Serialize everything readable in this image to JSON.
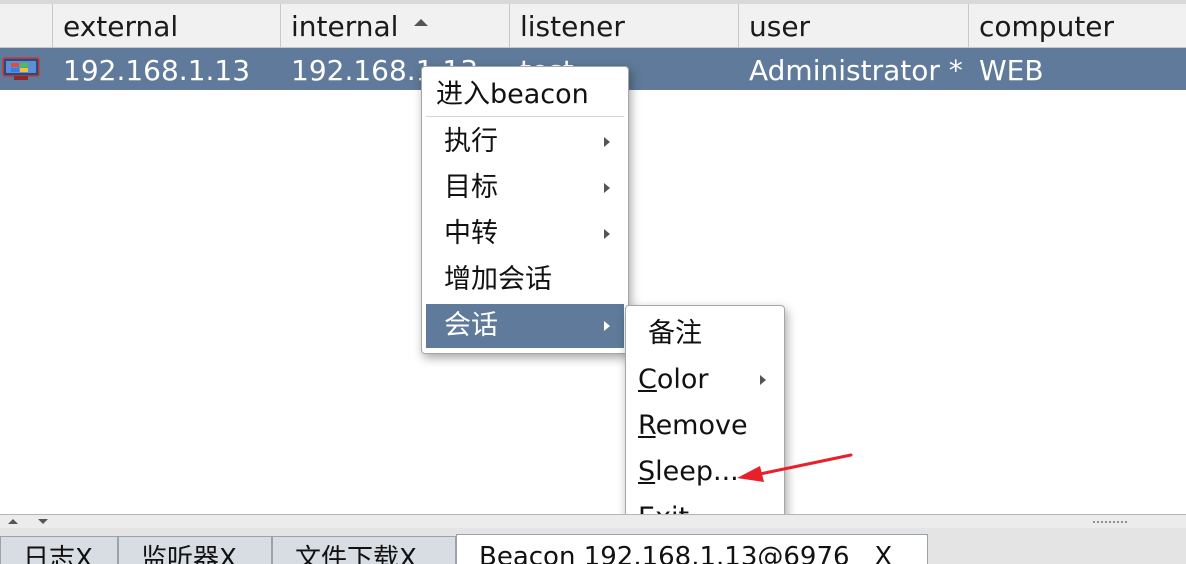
{
  "table": {
    "columns": {
      "external": "external",
      "internal": "internal",
      "listener": "listener",
      "user": "user",
      "computer": "computer"
    },
    "sorted_column": "internal",
    "rows": [
      {
        "external": "192.168.1.13",
        "internal": "192.168.1.13",
        "listener": "test",
        "user": "Administrator *",
        "computer": "WEB",
        "icon": "windows-session-icon"
      }
    ]
  },
  "context_menu": {
    "items": [
      {
        "label": "进入beacon",
        "has_submenu": false
      },
      {
        "label": "执行",
        "has_submenu": true
      },
      {
        "label": "目标",
        "has_submenu": true
      },
      {
        "label": "中转",
        "has_submenu": true
      },
      {
        "label": "增加会话",
        "has_submenu": false
      },
      {
        "label": "会话",
        "has_submenu": true,
        "active": true
      }
    ]
  },
  "submenu": {
    "items": [
      {
        "label": "备注",
        "mnemonic": "",
        "rest": "",
        "has_submenu": false
      },
      {
        "label": "Color",
        "mnemonic": "C",
        "rest": "olor",
        "has_submenu": true
      },
      {
        "label": "Remove",
        "mnemonic": "R",
        "rest": "emove",
        "has_submenu": false
      },
      {
        "label": "Sleep...",
        "mnemonic": "S",
        "rest": "leep...",
        "has_submenu": false
      },
      {
        "label": "Exit",
        "mnemonic": "E",
        "rest": "xit",
        "has_submenu": false
      }
    ]
  },
  "tabs": [
    {
      "label": "日志X"
    },
    {
      "label": "监听器X"
    },
    {
      "label": "文件下载X"
    },
    {
      "label": "Beacon 192.168.1.13@6976   X",
      "active": true
    }
  ],
  "colors": {
    "selection": "#5f7a9a",
    "annotation_arrow": "#e8202a"
  }
}
